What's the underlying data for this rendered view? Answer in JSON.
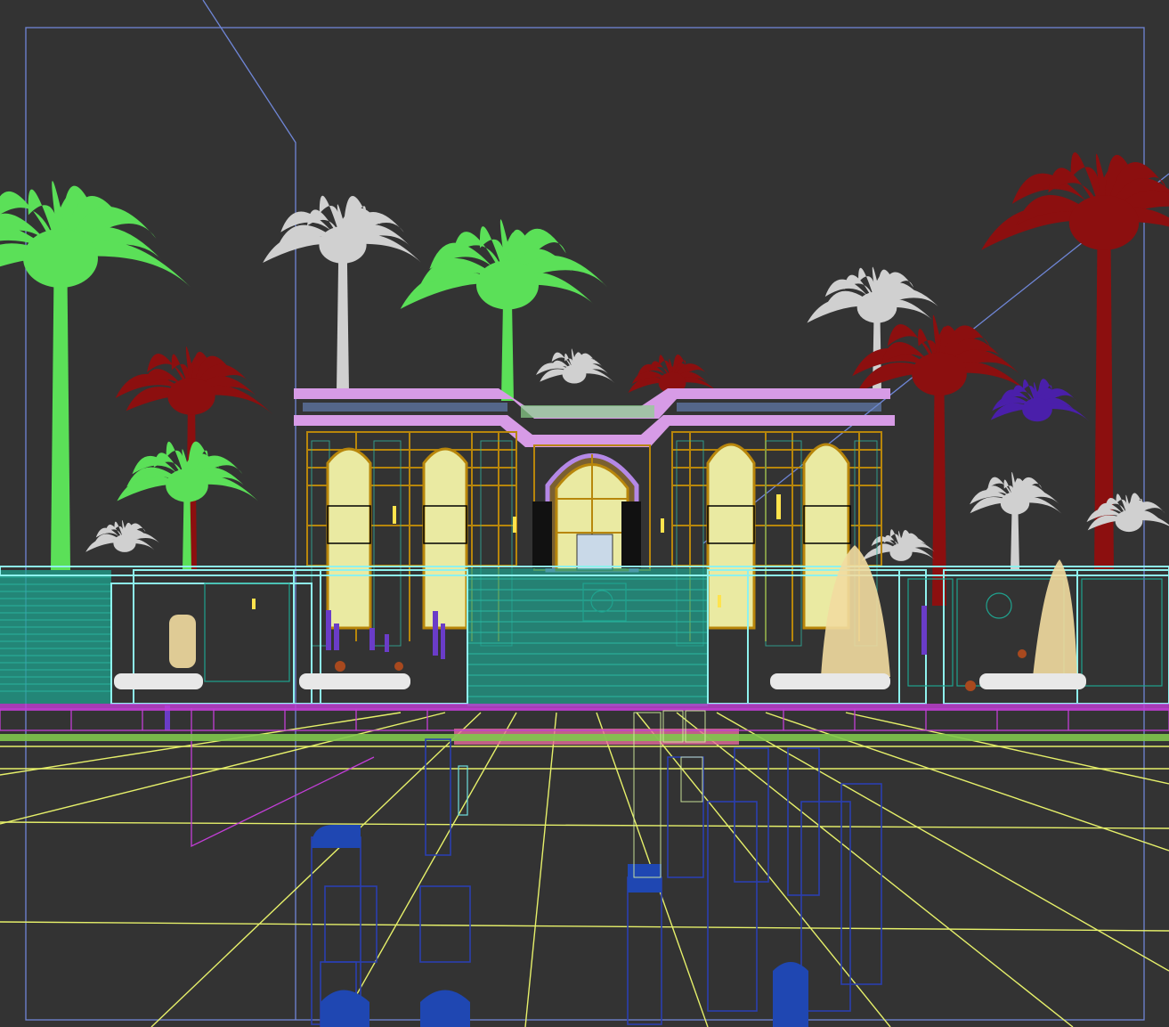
{
  "viewport": {
    "view_type": "3D wireframe perspective viewport",
    "background": "#333333"
  },
  "colors": {
    "safe_frame": "#6f86d6",
    "ground_grid": "#e6f06a",
    "palm_green": "#5be058",
    "palm_white": "#d0d0d0",
    "palm_red": "#8c0f0f",
    "palm_purple": "#4a1faa",
    "roof_pink": "#d79be6",
    "facade_cream": "#eaeaa2",
    "frame_gold": "#b8860b",
    "fence_teal": "#1fa38f",
    "fence_cyan": "#8ef2ee",
    "pavement_magenta": "#c23ed6",
    "hedge_white": "#e8e8e8",
    "column_black": "#111111",
    "light_blue_objects": "#2a3fb0",
    "object_outline": "#4a6fd8"
  },
  "icons": [
    "safe-frame",
    "ground-grid",
    "palm-tree",
    "villa-wireframe",
    "fence-wireframe",
    "light-fixture"
  ]
}
